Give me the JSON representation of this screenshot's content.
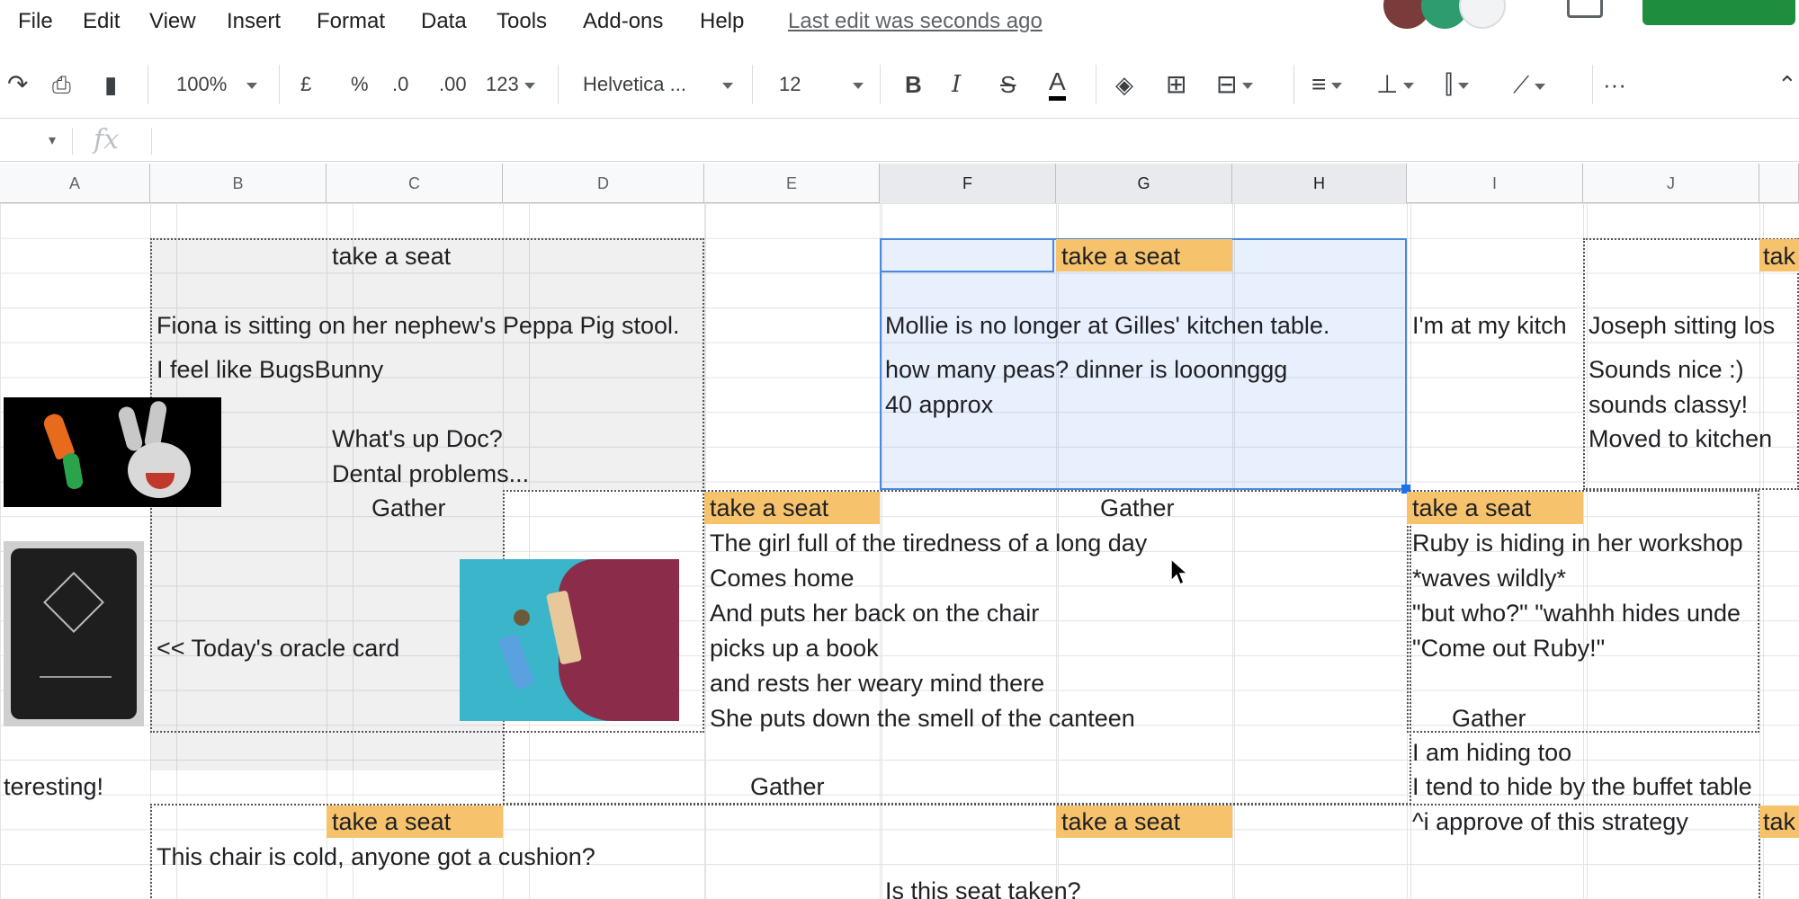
{
  "menu": {
    "items": [
      "File",
      "Edit",
      "View",
      "Insert",
      "Format",
      "Data",
      "Tools",
      "Add-ons",
      "Help"
    ],
    "last_edit": "Last edit was seconds ago"
  },
  "toolbar": {
    "zoom": "100%",
    "currency": "£",
    "percent": "%",
    "decimal_decrease": ".0",
    "decimal_increase": ".00",
    "number_format": "123",
    "font": "Helvetica ...",
    "font_size": "12",
    "bold": "B",
    "italic": "I",
    "strike": "S",
    "text_color": "A",
    "more": "···"
  },
  "formula_bar": {
    "fx": "fx"
  },
  "columns": [
    "A",
    "B",
    "C",
    "D",
    "E",
    "F",
    "G",
    "H",
    "I",
    "J"
  ],
  "cells": {
    "b_take_seat": "take a seat",
    "fiona": "Fiona is sitting on her nephew's Peppa Pig stool.",
    "bugs": "I feel like BugsBunny",
    "whats_up": "What's up Doc?",
    "dental": "Dental problems...",
    "gather_c": "Gather",
    "oracle": "<< Today's oracle card",
    "interesting": "teresting!",
    "take_seat_c2": "take a seat",
    "cold_chair": "This chair is cold, anyone got a cushion?",
    "f_take_seat": "take a seat",
    "mollie": "Mollie is no longer at Gilles' kitchen table.",
    "peas": "how many peas? dinner is looonnggg",
    "approx": "40 approx",
    "e_take_seat": "take a seat",
    "gather_g": "Gather",
    "poem1": "The girl full of the tiredness of a long day",
    "poem2": "Comes home",
    "poem3": "And puts her back on the chair",
    "poem4": "picks up a book",
    "poem5": "and rests her weary mind there",
    "poem6": "She puts down the smell of the canteen",
    "gather_e": "Gather",
    "take_seat_g2": "take a seat",
    "seat_taken": "Is this seat taken?",
    "kitchen": "I'm at my kitch",
    "joseph": "Joseph sitting los",
    "nice": "Sounds nice :)",
    "classy": "sounds classy!",
    "moved": "Moved to kitchen",
    "i_take_seat": "take a seat",
    "ruby": "Ruby is hiding in her workshop",
    "waves": "*waves wildly*",
    "who": "\"but who?\" \"wahhh hides unde",
    "come_out": "\"Come out Ruby!\"",
    "gather_i": "Gather",
    "hiding_too": "I am hiding too",
    "buffet": "I tend to hide by the buffet table",
    "approve": "^i approve of this strategy",
    "tak_j1": "tak",
    "tak_j2": "tak"
  },
  "colors": {
    "highlight": "#f6c26b",
    "selection": "#4a89dc",
    "share_green": "#1e8e3e"
  }
}
